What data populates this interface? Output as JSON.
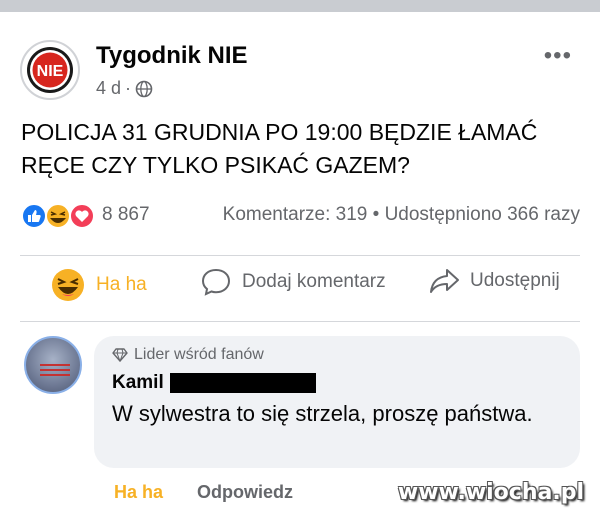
{
  "post": {
    "page_name": "Tygodnik NIE",
    "avatar_text": "NIE",
    "age": "4 d",
    "separator": "·",
    "more_menu": "•••",
    "text": "POLICJA 31 GRUDNIA PO 19:00 BĘDZIE ŁAMAĆ RĘCE CZY TYLKO PSIKAĆ GAZEM?",
    "reaction_count": "8 867",
    "comments_label": "Komentarze: 319",
    "stat_separator": "•",
    "shares_label": "Udostępniono 366 razy"
  },
  "actions": {
    "haha_label": "Ha ha",
    "comment_label": "Dodaj komentarz",
    "share_label": "Udostępnij"
  },
  "comment": {
    "badge_label": "Lider wśród fanów",
    "commenter_name": "Kamil",
    "text": "W sylwestra to się strzela, proszę państwa.",
    "haha_label": "Ha ha",
    "reply_label": "Odpowiedz"
  },
  "watermark": "www.wiocha.pl",
  "colors": {
    "haha_accent": "#f7b125",
    "secondary_text": "#65676b",
    "bubble_bg": "#f0f2f5",
    "like_blue": "#1877f2",
    "love_red": "#f33e58",
    "brand_red": "#d7261e"
  },
  "icons": [
    "nie-logo-icon",
    "globe-icon",
    "more-icon",
    "like-reaction-icon",
    "haha-reaction-icon",
    "love-reaction-icon",
    "haha-emoji-icon",
    "comment-icon",
    "share-icon",
    "diamond-badge-icon"
  ]
}
